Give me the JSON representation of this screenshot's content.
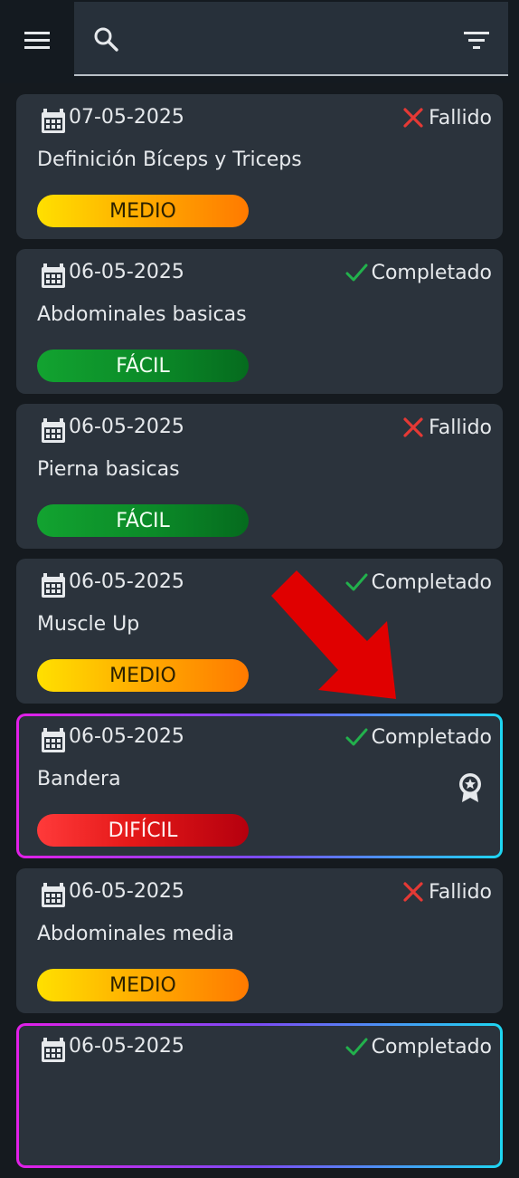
{
  "search": {
    "placeholder": ""
  },
  "icons": {
    "menu": "menu-icon",
    "search": "search-icon",
    "filter": "filter-icon",
    "calendar": "calendar-icon",
    "success": "check-icon",
    "failure": "x-icon",
    "medal": "medal-icon",
    "arrow": "arrow-icon"
  },
  "colors": {
    "success": "#22b14c",
    "failure": "#e53935",
    "arrow": "#e00000"
  },
  "workouts": [
    {
      "date": "07-05-2025",
      "status": "Fallido",
      "name": "Definición Bíceps y Triceps",
      "difficulty": "MEDIO"
    },
    {
      "date": "06-05-2025",
      "status": "Completado",
      "name": "Abdominales basicas",
      "difficulty": "FÁCIL"
    },
    {
      "date": "06-05-2025",
      "status": "Fallido",
      "name": "Pierna basicas",
      "difficulty": "FÁCIL"
    },
    {
      "date": "06-05-2025",
      "status": "Completado",
      "name": "Muscle Up",
      "difficulty": "MEDIO"
    },
    {
      "date": "06-05-2025",
      "status": "Completado",
      "name": "Bandera",
      "difficulty": "DIFÍCIL",
      "badge": "medal-icon"
    },
    {
      "date": "06-05-2025",
      "status": "Fallido",
      "name": "Abdominales media",
      "difficulty": "MEDIO"
    },
    {
      "date": "06-05-2025",
      "status": "Completado",
      "name": "",
      "difficulty": ""
    }
  ]
}
